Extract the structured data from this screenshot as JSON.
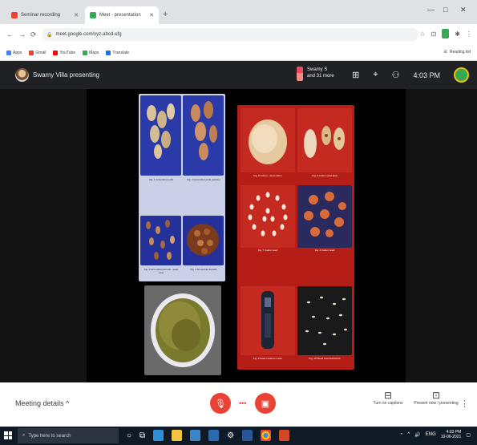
{
  "browser": {
    "tabs": [
      {
        "title": "Seminar recording",
        "favicon_color": "#ea4335"
      },
      {
        "title": "Meet - presentation",
        "favicon_color": "#34a853"
      }
    ],
    "new_tab": "+",
    "window_controls": {
      "minimize": "—",
      "restore": "□",
      "close": "✕"
    },
    "address": "meet.google.com/xyz-abcd-efg",
    "bookmarks": [
      {
        "label": "Apps",
        "color": "#4285f4"
      },
      {
        "label": "Gmail",
        "color": "#ea4335"
      },
      {
        "label": "YouTube",
        "color": "#ff0000"
      },
      {
        "label": "Maps",
        "color": "#34a853"
      },
      {
        "label": "Translate",
        "color": "#1a73e8"
      }
    ],
    "reading_list": "Reading list"
  },
  "meet": {
    "presenting_label": "Swamy Villa presenting",
    "recorder": {
      "line1": "Swamy S",
      "line2": "and 31 more"
    },
    "time": "4:03 PM",
    "meeting_details": "Meeting details",
    "tools": {
      "captions": "Turn on captions",
      "present": "Present now / presenting"
    },
    "left_plates": [
      {
        "caption": "Fig. 1 Groundnut pods"
      },
      {
        "caption": "Fig. 2 Groundnut pods (variety)"
      },
      {
        "caption": "Fig. 3 Groundnut kernels - seed coat"
      },
      {
        "caption": "Fig. 4 Groundnut kernels"
      }
    ],
    "right_plates": [
      {
        "caption": "Fig. 5 Cotton - seed cotton"
      },
      {
        "caption": "Fig. 6 Cotton seed (lint)"
      },
      {
        "caption": "Fig. 7 Castor seed"
      },
      {
        "caption": "Fig. 8 Castor seed"
      },
      {
        "caption": "Fig. 9 Seed moisture meter"
      },
      {
        "caption": "Fig. 10 Weed seed admixture"
      }
    ]
  },
  "taskbar": {
    "search_placeholder": "Type here to search",
    "time": "4:03 PM",
    "date": "10-06-2021",
    "language": "ENG"
  }
}
